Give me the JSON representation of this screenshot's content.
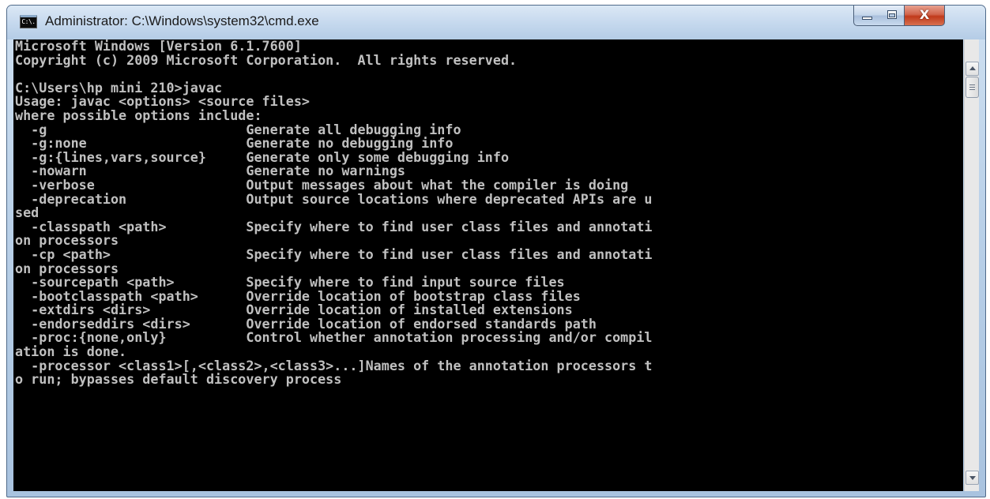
{
  "window": {
    "title": "Administrator: C:\\Windows\\system32\\cmd.exe",
    "app_icon_text": "C:\\.",
    "controls": {
      "minimize": "minimize",
      "maximize": "maximize",
      "close_glyph": "X"
    }
  },
  "console": {
    "text": "Microsoft Windows [Version 6.1.7600]\nCopyright (c) 2009 Microsoft Corporation.  All rights reserved.\n\nC:\\Users\\hp mini 210>javac\nUsage: javac <options> <source files>\nwhere possible options include:\n  -g                         Generate all debugging info\n  -g:none                    Generate no debugging info\n  -g:{lines,vars,source}     Generate only some debugging info\n  -nowarn                    Generate no warnings\n  -verbose                   Output messages about what the compiler is doing\n  -deprecation               Output source locations where deprecated APIs are u\nsed\n  -classpath <path>          Specify where to find user class files and annotati\non processors\n  -cp <path>                 Specify where to find user class files and annotati\non processors\n  -sourcepath <path>         Specify where to find input source files\n  -bootclasspath <path>      Override location of bootstrap class files\n  -extdirs <dirs>            Override location of installed extensions\n  -endorseddirs <dirs>       Override location of endorsed standards path\n  -proc:{none,only}          Control whether annotation processing and/or compil\nation is done.\n  -processor <class1>[,<class2>,<class3>...]Names of the annotation processors t\no run; bypasses default discovery process"
  },
  "colors": {
    "console_bg": "#000000",
    "console_fg": "#c0c0c0",
    "close_button": "#c63b1d"
  },
  "icons": [
    "cmd-app-icon",
    "minimize-icon",
    "maximize-icon",
    "close-icon",
    "scroll-up-arrow-icon",
    "scroll-down-arrow-icon"
  ]
}
